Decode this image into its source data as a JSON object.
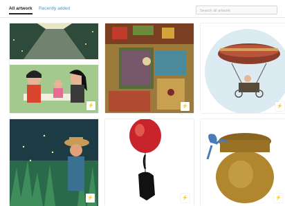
{
  "tabs": {
    "all_artwork": "All artwork",
    "recently_added": "Recently added"
  },
  "search": {
    "placeholder": "Search all artwork"
  },
  "accent_color": "#2f9ed8",
  "tiles": [
    {
      "subject": "couple dinner scene",
      "badge_icon": "lightning-icon"
    },
    {
      "subject": "cluttered room overhead",
      "badge_icon": "lightning-icon"
    },
    {
      "subject": "airship with rider",
      "badge_icon": "lightning-icon"
    },
    {
      "subject": "boy in tall grass with fireflies",
      "badge_icon": "lightning-icon"
    },
    {
      "subject": "red balloon with elephant silhouette",
      "badge_icon": "lightning-icon"
    },
    {
      "subject": "honey pot with blue bow",
      "badge_icon": "lightning-icon"
    }
  ],
  "badge_glyph": "⚡"
}
